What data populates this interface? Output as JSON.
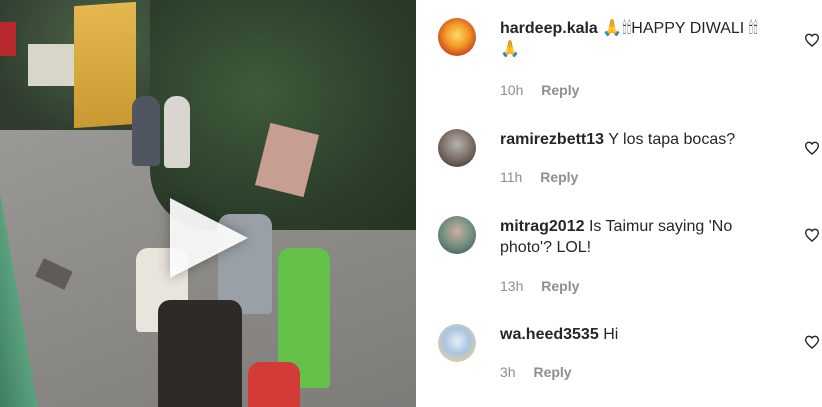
{
  "video": {
    "play_icon": "play-icon"
  },
  "comments": [
    {
      "username": "hardeep.kala",
      "text": "🙏🕯🕯HAPPY DIWALI 🕯🕯 🙏",
      "time": "10h",
      "reply": "Reply",
      "avatar_icon": "avatar",
      "like_icon": "heart-icon"
    },
    {
      "username": "ramirezbett13",
      "text": "Y los tapa bocas?",
      "time": "11h",
      "reply": "Reply",
      "avatar_icon": "avatar",
      "like_icon": "heart-icon"
    },
    {
      "username": "mitrag2012",
      "text": "Is Taimur saying 'No photo'? LOL!",
      "time": "13h",
      "reply": "Reply",
      "avatar_icon": "avatar",
      "like_icon": "heart-icon"
    },
    {
      "username": "wa.heed3535",
      "text": "Hi",
      "time": "3h",
      "reply": "Reply",
      "avatar_icon": "avatar",
      "like_icon": "heart-icon"
    }
  ]
}
